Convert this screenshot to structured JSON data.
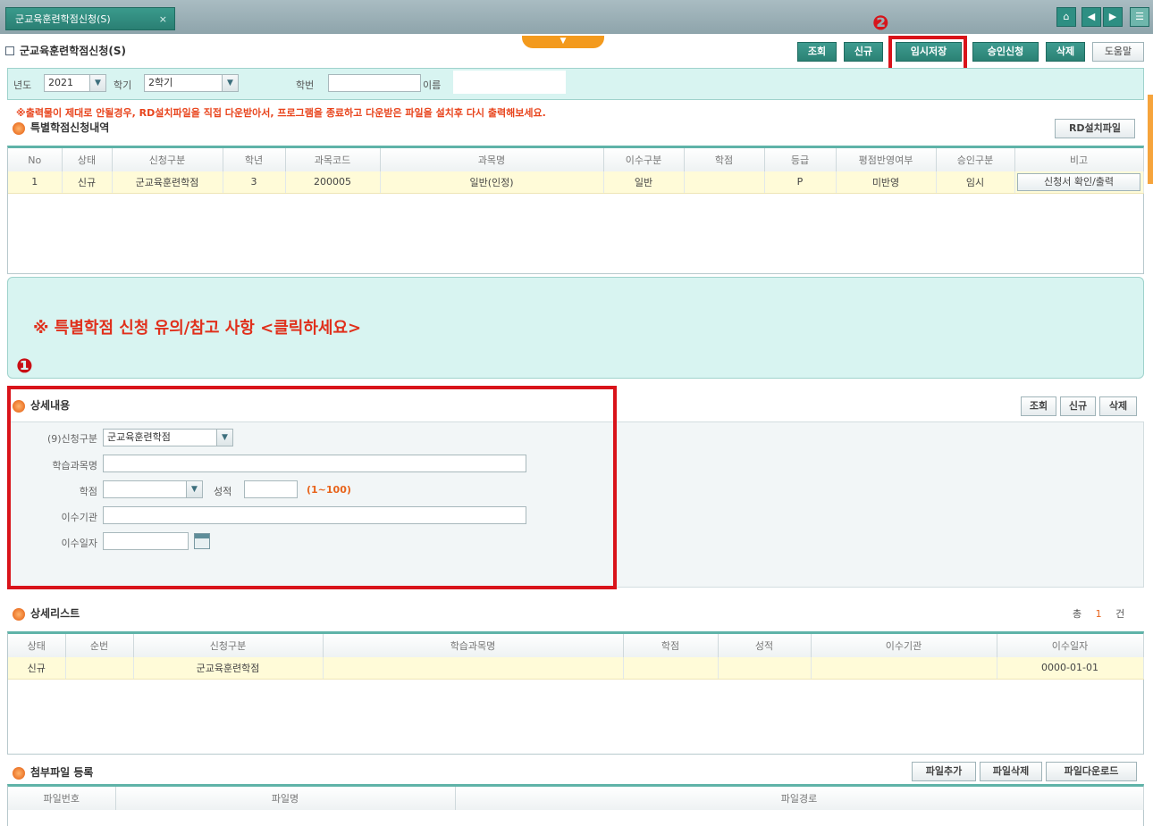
{
  "tab": {
    "title": "군교육훈련학점신청(S)",
    "close": "×"
  },
  "nav_icons": [
    "home-icon",
    "arrow-left-icon",
    "arrow-right-icon",
    "menu-icon"
  ],
  "page": {
    "title": "군교육훈련학점신청(S)"
  },
  "markers": {
    "one": "❶",
    "two": "❷"
  },
  "top_buttons": [
    "조회",
    "신규",
    "임시저장",
    "승인신청",
    "삭제",
    "도움말"
  ],
  "search": {
    "year_label": "년도",
    "year_value": "2021",
    "term_label": "학기",
    "term_value": "2학기",
    "student_no_label": "학번",
    "student_no_value": "",
    "name_label": "이름",
    "name_value": ""
  },
  "warning": "※출력물이 제대로 안될경우, RD설치파일을 직접 다운받아서, 프로그램을 종료하고 다운받은 파일을 설치후 다시 출력해보세요.",
  "special": {
    "title": "특별학점신청내역",
    "rd_button": "RD설치파일",
    "headers": [
      "No",
      "상태",
      "신청구분",
      "학년",
      "과목코드",
      "과목명",
      "이수구분",
      "학점",
      "등급",
      "평점반영여부",
      "승인구분",
      "비고"
    ],
    "rows": [
      {
        "no": "1",
        "status": "신규",
        "type": "군교육훈련학점",
        "grade_year": "3",
        "code": "200005",
        "subject": "일반(인정)",
        "completion": "일반",
        "credit": "",
        "grade": "P",
        "reflect": "미반영",
        "approval": "임시",
        "note_button": "신청서 확인/출력"
      }
    ]
  },
  "notice": "※ 특별학점 신청 유의/참고 사항 <클릭하세요>",
  "detail": {
    "title": "상세내용",
    "buttons": [
      "조회",
      "신규",
      "삭제"
    ],
    "type_label": "(9)신청구분",
    "type_value": "군교육훈련학점",
    "course_label": "학습과목명",
    "course_value": "",
    "credit_label": "학점",
    "credit_value": "",
    "score_label": "성적",
    "score_value": "",
    "score_hint": "(1~100)",
    "institution_label": "이수기관",
    "institution_value": "",
    "date_label": "이수일자",
    "date_value": ""
  },
  "detail_list": {
    "title": "상세리스트",
    "total_prefix": "총",
    "total_count": "1",
    "total_suffix": "건",
    "headers": [
      "상태",
      "순번",
      "신청구분",
      "학습과목명",
      "학점",
      "성적",
      "이수기관",
      "이수일자"
    ],
    "rows": [
      {
        "status": "신규",
        "seq": "",
        "type": "군교육훈련학점",
        "course": "",
        "credit": "",
        "score": "",
        "institution": "",
        "date": "0000-01-01"
      }
    ]
  },
  "attachments": {
    "title": "첨부파일 등록",
    "buttons": [
      "파일추가",
      "파일삭제",
      "파일다운로드"
    ],
    "headers": [
      "파일번호",
      "파일명",
      "파일경로"
    ]
  }
}
